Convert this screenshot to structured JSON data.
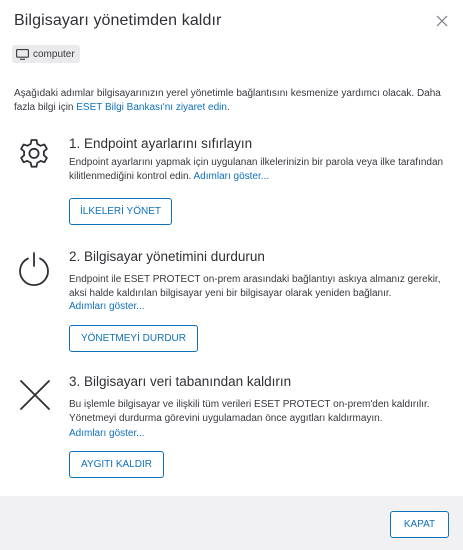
{
  "dialog": {
    "title": "Bilgisayarı yönetimden kaldır",
    "close_icon": "close-icon"
  },
  "device": {
    "icon": "monitor-icon",
    "name": "computer"
  },
  "intro": {
    "text": "Aşağıdaki adımlar bilgisayarınızın yerel yönetimle bağlantısını kesmenize yardımcı olacak. Daha fazla bilgi için ",
    "link": "ESET Bilgi Bankası'nı ziyaret edin",
    "end": "."
  },
  "steps": [
    {
      "icon": "gear-icon",
      "title": "1. Endpoint ayarlarını sıfırlayın",
      "desc": "Endpoint ayarlarını yapmak için uygulanan ilkelerinizin bir parola veya ilke tarafından kilitlenmediğini kontrol edin. ",
      "link": "Adımları göster...",
      "button": "İLKELERİ YÖNET"
    },
    {
      "icon": "power-icon",
      "title": "2. Bilgisayar yönetimini durdurun",
      "desc": "Endpoint ile ESET PROTECT on-prem arasındaki bağlantıyı askıya almanız gerekir, aksi halde kaldırılan bilgisayar yeni bir bilgisayar olarak yeniden bağlanır.",
      "link": "Adımları göster...",
      "button": "YÖNETMEYİ DURDUR"
    },
    {
      "icon": "x-mark-icon",
      "title": "3. Bilgisayarı veri tabanından kaldırın",
      "desc": "Bu işlemle bilgisayar ve ilişkili tüm verileri ESET PROTECT on-prem'den kaldırılır. Yönetmeyi durdurma görevini uygulamadan önce aygıtları kaldırmayın.",
      "link": "Adımları göster...",
      "button": "AYGITI KALDIR"
    }
  ],
  "footer": {
    "close_button": "KAPAT"
  },
  "colors": {
    "accent": "#0f71ba",
    "text": "#38383f",
    "footer_bg": "#f1f1f3"
  }
}
